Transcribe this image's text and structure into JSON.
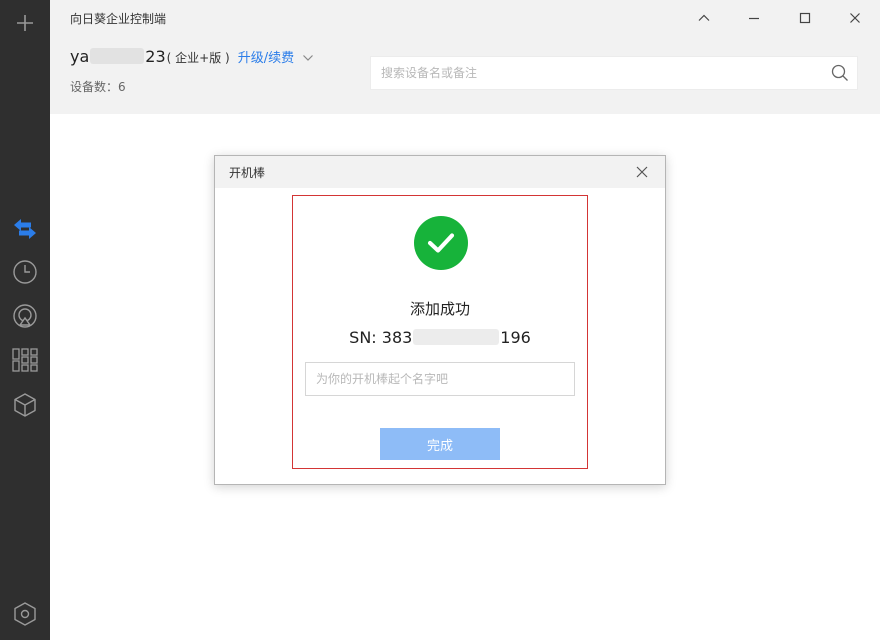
{
  "window": {
    "title": "向日葵企业控制端"
  },
  "account": {
    "name_prefix": "ya",
    "name_suffix": "23",
    "edition": "( 企业+版 )",
    "upgrade_label": "升级/续费",
    "device_count": "设备数：6"
  },
  "search": {
    "placeholder": "搜索设备名或备注"
  },
  "dialog": {
    "title": "开机棒",
    "success_text": "添加成功",
    "sn_prefix": "SN: 383",
    "sn_suffix": "196",
    "name_placeholder": "为你的开机棒起个名字吧",
    "done_label": "完成"
  },
  "sidebar": {
    "items": [
      {
        "name": "add",
        "icon": "plus-icon"
      },
      {
        "name": "remote",
        "icon": "transfer-arrows-icon",
        "active": true
      },
      {
        "name": "history",
        "icon": "clock-icon"
      },
      {
        "name": "screen-cast",
        "icon": "airplay-icon"
      },
      {
        "name": "apps",
        "icon": "apps-grid-icon"
      },
      {
        "name": "devices",
        "icon": "box-icon"
      },
      {
        "name": "settings",
        "icon": "hexagon-settings-icon"
      }
    ]
  },
  "colors": {
    "sidebar_bg": "#2f2f2f",
    "accent": "#2b7de9",
    "success": "#17b33a",
    "highlight": "#d33535",
    "button_disabled": "#8ebcf7"
  }
}
